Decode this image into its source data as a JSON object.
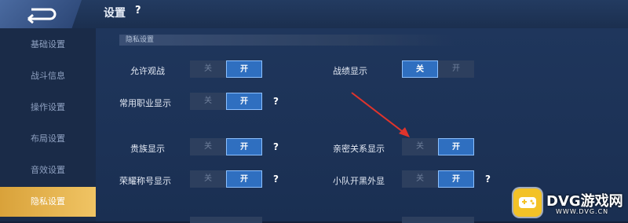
{
  "header": {
    "title": "设置",
    "help": "?"
  },
  "sidebar": {
    "items": [
      {
        "label": "基础设置"
      },
      {
        "label": "战斗信息"
      },
      {
        "label": "操作设置"
      },
      {
        "label": "布局设置"
      },
      {
        "label": "音效设置"
      },
      {
        "label": "隐私设置",
        "active": true
      }
    ]
  },
  "section": {
    "title": "隐私设置"
  },
  "settings": {
    "allow_spectate": {
      "label": "允许观战",
      "off": "关",
      "on": "开",
      "value": "on"
    },
    "record_display": {
      "label": "战绩显示",
      "off": "关",
      "on": "开",
      "value": "off"
    },
    "common_role_display": {
      "label": "常用职业显示",
      "off": "关",
      "on": "开",
      "value": "on",
      "help": "?"
    },
    "noble_display": {
      "label": "贵族显示",
      "off": "关",
      "on": "开",
      "value": "on",
      "help": "?"
    },
    "intimate_display": {
      "label": "亲密关系显示",
      "off": "关",
      "on": "开",
      "value": "on"
    },
    "honor_title_display": {
      "label": "荣耀称号显示",
      "off": "关",
      "on": "开",
      "value": "on",
      "help": "?"
    },
    "team_open_outfit": {
      "label": "小队开黑外显",
      "off": "关",
      "on": "开",
      "value": "on",
      "help": "?"
    }
  },
  "watermark": {
    "text": "DVG游戏网",
    "url": "WWW.DVG.CN"
  },
  "colors": {
    "accent": "#2f6fc0",
    "active_tab": "#e0aa45",
    "arrow": "#e0342c"
  }
}
